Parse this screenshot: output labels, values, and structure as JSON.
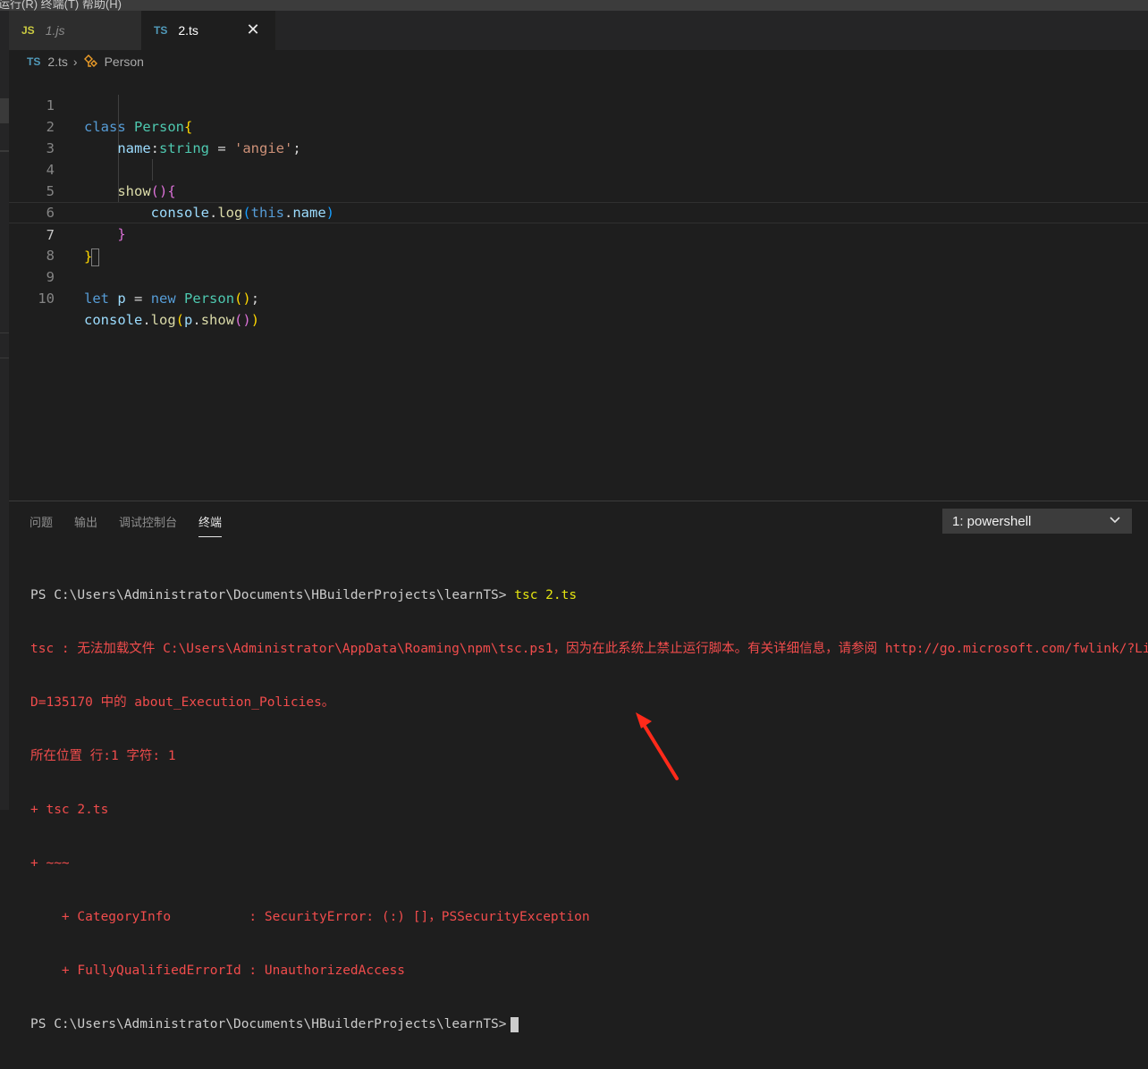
{
  "window": {
    "menu_fragment": "运行(R)  终端(T)  帮助(H)"
  },
  "tabs": [
    {
      "lang": "JS",
      "name": "1.js",
      "active": false
    },
    {
      "lang": "TS",
      "name": "2.ts",
      "active": true,
      "close": "✕"
    }
  ],
  "breadcrumb": {
    "lang": "TS",
    "file": "2.ts",
    "separator": "›",
    "symbol": "Person",
    "symbol_icon": "class-icon"
  },
  "editor": {
    "line_numbers": [
      "1",
      "2",
      "3",
      "4",
      "5",
      "6",
      "7",
      "8",
      "9",
      "10"
    ],
    "current_line": 7,
    "code": [
      "class Person{",
      "    name:string = 'angie';",
      "",
      "    show(){",
      "        console.log(this.name)",
      "    }",
      "}",
      "",
      "let p = new Person();",
      "console.log(p.show())"
    ]
  },
  "panel": {
    "tabs": [
      "问题",
      "输出",
      "调试控制台",
      "终端"
    ],
    "active_tab": "终端",
    "terminal_select": "1: powershell"
  },
  "terminal": {
    "prompt": "PS C:\\Users\\Administrator\\Documents\\HBuilderProjects\\learnTS>",
    "command": "tsc 2.ts",
    "error_lines": [
      "tsc : 无法加载文件 C:\\Users\\Administrator\\AppData\\Roaming\\npm\\tsc.ps1，因为在此系统上禁止运行脚本。有关详细信息，请参阅 http://go.microsoft.com/fwlink/?LinkI",
      "D=135170 中的 about_Execution_Policies。",
      "所在位置 行:1 字符: 1",
      "+ tsc 2.ts",
      "+ ~~~",
      "    + CategoryInfo          : SecurityError: (:) []，PSSecurityException",
      "    + FullyQualifiedErrorId : UnauthorizedAccess"
    ]
  },
  "colors": {
    "keyword": "#569cd6",
    "class_name": "#4ec9b0",
    "property": "#9cdcfe",
    "string": "#ce9178",
    "function": "#dcdcaa",
    "error": "#f14c4c",
    "annotation_arrow": "#ff2a1a"
  }
}
